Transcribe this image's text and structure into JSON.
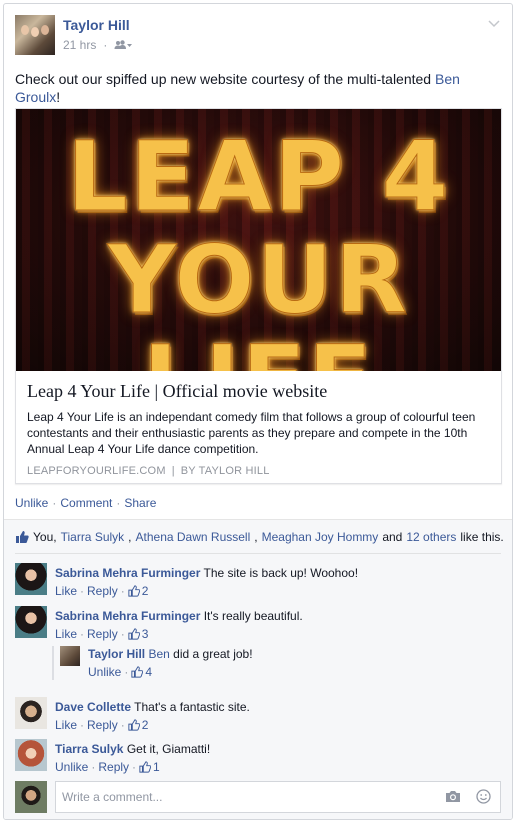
{
  "post": {
    "author": "Taylor Hill",
    "time": "21 hrs",
    "audience_icon": "friends-icon",
    "text_before": "Check out our spiffed up new website courtesy of the multi-talented ",
    "mention": "Ben Groulx",
    "text_after": "!"
  },
  "link_card": {
    "hero_line1": "LEAP 4",
    "hero_line2": "YOUR LIFE",
    "title": "Leap 4 Your Life | Official movie website",
    "description": "Leap 4 Your Life is an independant comedy film that follows a group of colourful teen contestants and their enthusiastic parents as they prepare and compete in the 10th Annual Leap 4 Your Life dance competition.",
    "domain": "LEAPFORYOURLIFE.COM",
    "source_sep": "|",
    "byline": "BY TAYLOR HILL"
  },
  "actions": {
    "unlike": "Unlike",
    "comment": "Comment",
    "share": "Share",
    "sep": "·"
  },
  "likes": {
    "you": "You,",
    "names": [
      "Tiarra Sulyk",
      "Athena Dawn Russell",
      "Meaghan Joy Hommy"
    ],
    "and": "and",
    "others": "12 others",
    "tail": "like this."
  },
  "comments": [
    {
      "name": "Sabrina Mehra Furminger",
      "text": "The site is back up! Woohoo!",
      "action": "Like",
      "reply": "Reply",
      "likes": "2"
    },
    {
      "name": "Sabrina Mehra Furminger",
      "text": "It's really beautiful.",
      "action": "Like",
      "reply": "Reply",
      "likes": "3"
    },
    {
      "name": "Taylor Hill",
      "mention": "Ben",
      "text": "did a great job!",
      "action": "Unlike",
      "likes": "4"
    },
    {
      "name": "Dave Collette",
      "text": "That's a fantastic site.",
      "action": "Like",
      "reply": "Reply",
      "likes": "2"
    },
    {
      "name": "Tiarra Sulyk",
      "text": "Get it, Giamatti!",
      "action": "Unlike",
      "reply": "Reply",
      "likes": "1"
    }
  ],
  "composer": {
    "placeholder": "Write a comment..."
  },
  "colors": {
    "link": "#3b5998",
    "meta": "#9197a3",
    "ufi_bg": "#f6f7f9"
  }
}
